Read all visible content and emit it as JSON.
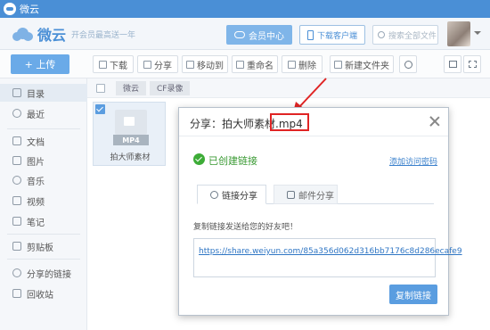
{
  "window": {
    "title": "微云"
  },
  "header": {
    "brand": "微云",
    "promo": "开会员最高送一年",
    "member_btn": "会员中心",
    "download_client": "下载客户端",
    "search_placeholder": "搜索全部文件"
  },
  "toolbar": {
    "upload": "+ 上传",
    "download": "下载",
    "share": "分享",
    "move": "移动到",
    "rename": "重命名",
    "delete": "删除",
    "new_folder": "新建文件夹"
  },
  "sidebar": {
    "items": [
      {
        "label": "目录"
      },
      {
        "label": "最近"
      },
      {
        "label": "文档"
      },
      {
        "label": "图片"
      },
      {
        "label": "音乐"
      },
      {
        "label": "视频"
      },
      {
        "label": "笔记"
      },
      {
        "label": "剪贴板"
      },
      {
        "label": "分享的链接"
      },
      {
        "label": "回收站"
      }
    ]
  },
  "breadcrumb": {
    "items": [
      "微云",
      "CF录像"
    ]
  },
  "file": {
    "type_badge": "MP4",
    "name": "拍大师素材"
  },
  "dialog": {
    "title": "分享：拍大师素材.mp4",
    "created_text": "已创建链接",
    "add_password_link": "添加访问密码",
    "tabs": [
      "链接分享",
      "邮件分享"
    ],
    "copy_hint": "复制链接发送给您的好友吧！",
    "share_url": "https://share.weiyun.com/85a356d062d316bb7176c8d286ecafe9",
    "copy_button": "复制链接"
  },
  "colors": {
    "accent": "#4a8fd6",
    "success": "#3dac37",
    "annotation": "#e02424"
  }
}
